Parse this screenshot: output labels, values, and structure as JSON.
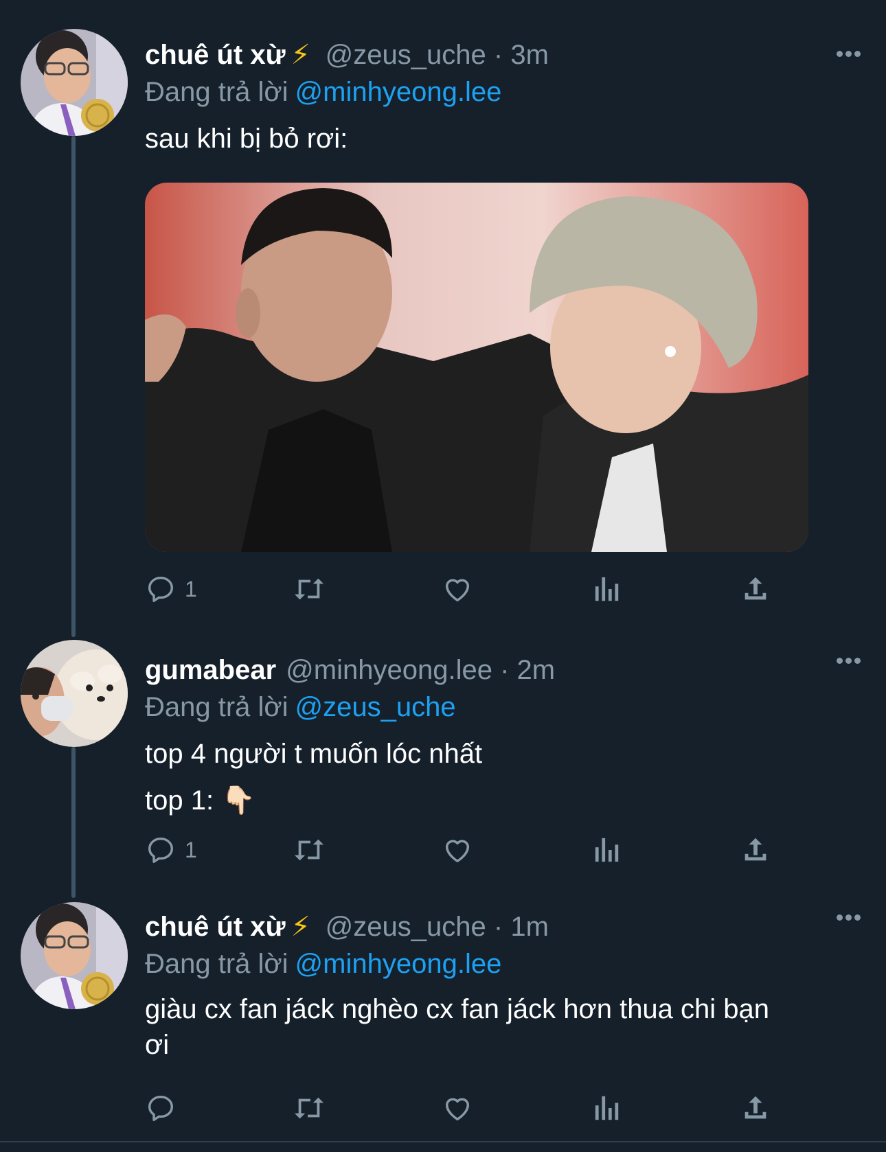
{
  "colors": {
    "background": "#15202b",
    "secondary_text": "#8899a6",
    "link": "#1da1f2",
    "thread_line": "#3d5466"
  },
  "tweets": [
    {
      "name": "chuê út xừ",
      "badge": "⚡",
      "handle": "@zeus_uche",
      "separator": "·",
      "time": "3m",
      "reply_prefix": "Đang trả lời",
      "reply_to": "@minhyeong.lee",
      "text_lines": [
        "sau khi bị bỏ rơi:"
      ],
      "has_media": true,
      "reply_count": "1",
      "icons": [
        "reply-icon",
        "retweet-icon",
        "like-icon",
        "analytics-icon",
        "share-icon"
      ]
    },
    {
      "name": "gumabear",
      "badge": "",
      "handle": "@minhyeong.lee",
      "separator": "·",
      "time": "2m",
      "reply_prefix": "Đang trả lời",
      "reply_to": "@zeus_uche",
      "text_lines": [
        "top 4 người t muốn lóc nhất",
        "top 1: 👇🏻"
      ],
      "has_media": false,
      "reply_count": "1",
      "icons": [
        "reply-icon",
        "retweet-icon",
        "like-icon",
        "analytics-icon",
        "share-icon"
      ]
    },
    {
      "name": "chuê út xừ",
      "badge": "⚡",
      "handle": "@zeus_uche",
      "separator": "·",
      "time": "1m",
      "reply_prefix": "Đang trả lời",
      "reply_to": "@minhyeong.lee",
      "text_lines": [
        "giàu cx fan jáck nghèo cx fan jáck hơn thua chi bạn",
        "ơi"
      ],
      "has_media": false,
      "reply_count": "",
      "icons": [
        "reply-icon",
        "retweet-icon",
        "like-icon",
        "analytics-icon",
        "share-icon"
      ]
    }
  ]
}
